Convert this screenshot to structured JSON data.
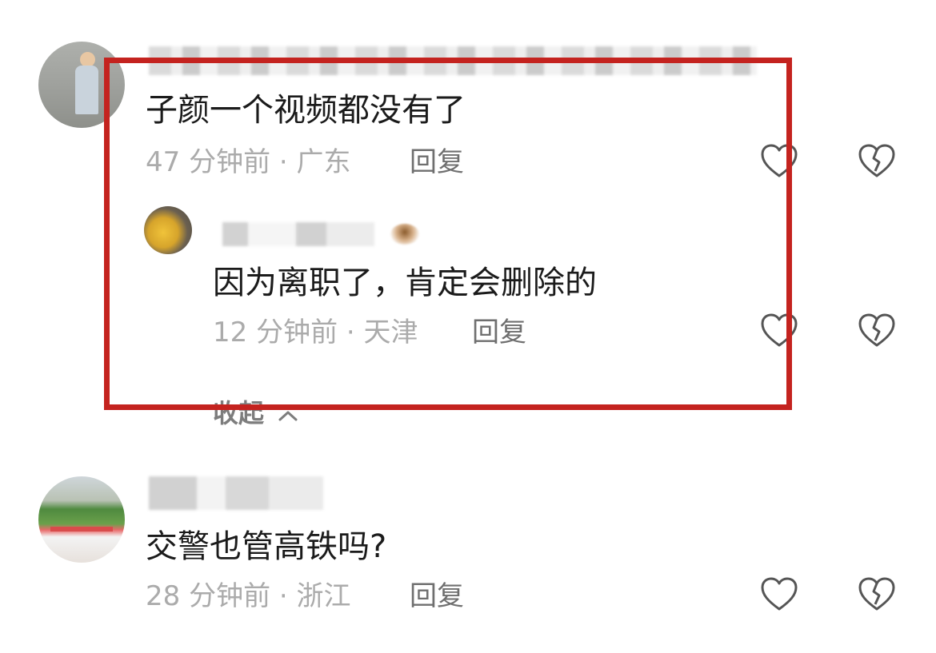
{
  "comments": [
    {
      "text": "子颜一个视频都没有了",
      "meta": "47 分钟前 · 广东",
      "reply_label": "回复",
      "replies": [
        {
          "text": "因为离职了，肯定会删除的",
          "meta": "12 分钟前 · 天津",
          "reply_label": "回复"
        }
      ],
      "collapse_label": "收起"
    },
    {
      "text": "交警也管高铁吗?",
      "meta": "28 分钟前 · 浙江",
      "reply_label": "回复"
    }
  ],
  "colors": {
    "highlight_border": "#c4231f",
    "meta_text": "#ababab",
    "reply_text": "#6f6f6f",
    "main_text": "#1b1b1b",
    "icon_stroke": "#555555"
  },
  "icons": {
    "like": "heart-outline-icon",
    "dislike": "broken-heart-outline-icon",
    "collapse": "chevron-up-icon"
  }
}
